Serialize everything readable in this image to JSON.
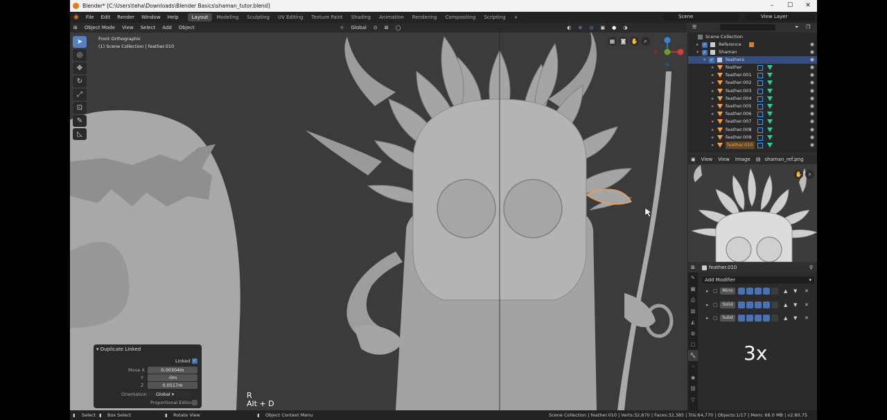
{
  "window": {
    "title": "Blender* [C:\\Users\\teha\\Downloads\\Blender Basics\\shaman_tutor.blend]",
    "controls": [
      "–",
      "☐",
      "✕"
    ]
  },
  "menubar": {
    "items": [
      "File",
      "Edit",
      "Render",
      "Window",
      "Help"
    ],
    "workspaces": [
      "Layout",
      "Modeling",
      "Sculpting",
      "UV Editing",
      "Texture Paint",
      "Shading",
      "Animation",
      "Rendering",
      "Compositing",
      "Scripting"
    ],
    "add_workspace": "+",
    "scene": "Scene",
    "view_layer": "View Layer"
  },
  "viewport": {
    "mode": "Object Mode",
    "menus": [
      "View",
      "Select",
      "Add",
      "Object"
    ],
    "orientation": "Global",
    "view_name": "Front Orthographic",
    "collection_info": "(1) Scene Collection | feather.010",
    "key_hint_1": "R",
    "key_hint_2": "Alt + D",
    "gizmo_axes": {
      "x": "X",
      "y": "Y",
      "z": "Z"
    }
  },
  "operator_panel": {
    "title": "Duplicate Linked",
    "linked_label": "Linked",
    "linked_checked": true,
    "move_x_label": "Move X",
    "move_x": "0.00304m",
    "move_y_label": "Y",
    "move_y": "-0m",
    "move_z_label": "Z",
    "move_z": "0.0517m",
    "orientation_label": "Orientation",
    "orientation": "Global",
    "proportional_label": "Proportional Editing",
    "proportional_checked": false
  },
  "outliner": {
    "items": [
      {
        "label": "Scene Collection",
        "type": "scene"
      },
      {
        "label": "Reference",
        "type": "collection"
      },
      {
        "label": "Shaman",
        "type": "collection"
      },
      {
        "label": "feathers",
        "type": "collection",
        "selected": true
      },
      {
        "label": "feather",
        "type": "mesh"
      },
      {
        "label": "feather.001",
        "type": "mesh"
      },
      {
        "label": "feather.002",
        "type": "mesh"
      },
      {
        "label": "feather.003",
        "type": "mesh"
      },
      {
        "label": "feather.004",
        "type": "mesh"
      },
      {
        "label": "feather.005",
        "type": "mesh"
      },
      {
        "label": "feather.006",
        "type": "mesh"
      },
      {
        "label": "feather.007",
        "type": "mesh"
      },
      {
        "label": "feather.008",
        "type": "mesh"
      },
      {
        "label": "feather.009",
        "type": "mesh"
      },
      {
        "label": "feather.010",
        "type": "mesh",
        "active": true
      }
    ]
  },
  "image_editor": {
    "menus": [
      "View",
      "View",
      "Image"
    ],
    "image_name": "shaman_ref.png"
  },
  "properties": {
    "object_name": "feather.010",
    "add_modifier": "Add Modifier",
    "modifiers": [
      "Mirro",
      "Solid",
      "Subd"
    ],
    "overlay_text": "3x"
  },
  "statusbar": {
    "select": "Select",
    "box_select": "Box Select",
    "rotate_view": "Rotate View",
    "context_menu": "Object Context Menu",
    "stats": "Scene Collection | feather.010 | Verts:32,670 | Faces:32,385 | Tris:64,770 | Objects:1/17 | Mem: 66.0 MB | v2.80.75"
  },
  "colors": {
    "accent_blue": "#4772b3",
    "selection_orange": "#ff9e3d",
    "viewport_bg": "#3a3a3a"
  }
}
